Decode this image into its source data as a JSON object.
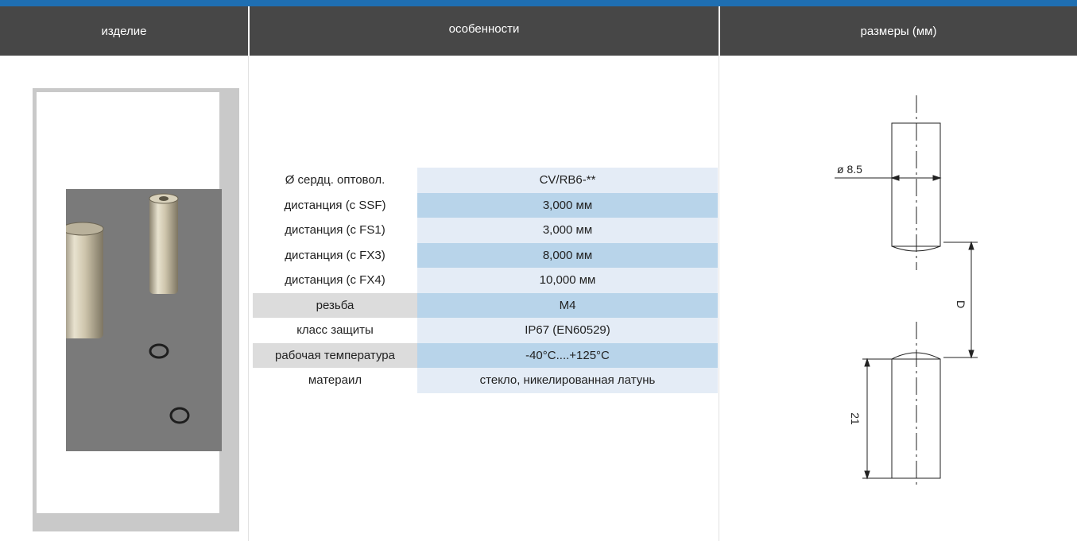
{
  "header": {
    "col_product": "изделие",
    "col_features": "особенности",
    "col_dimensions": "размеры (мм)"
  },
  "features": [
    {
      "label": "Ø сердц. оптовол.",
      "value": "CV/RB6-**"
    },
    {
      "label": "дистанция (с SSF)",
      "value": "3,000 мм"
    },
    {
      "label": "дистанция (с FS1)",
      "value": "3,000 мм"
    },
    {
      "label": "дистанция (с FX3)",
      "value": "8,000 мм"
    },
    {
      "label": "дистанция (с FX4)",
      "value": "10,000 мм"
    },
    {
      "label": "резьба",
      "value": "M4"
    },
    {
      "label": "класс защиты",
      "value": "IP67 (EN60529)"
    },
    {
      "label": "рабочая температура",
      "value": "-40°C....+125°C"
    },
    {
      "label": "матераил",
      "value": "стекло, никелированная латунь"
    }
  ],
  "drawing": {
    "diameter_label": "ø 8.5",
    "distance_label": "D",
    "length_label": "21"
  },
  "colors": {
    "header_bg": "#474747",
    "accent_stripe": "#1f6fb2",
    "row_light": "#e4ecf6",
    "row_blue": "#b8d4ea",
    "label_grey": "#dcdcdc"
  }
}
